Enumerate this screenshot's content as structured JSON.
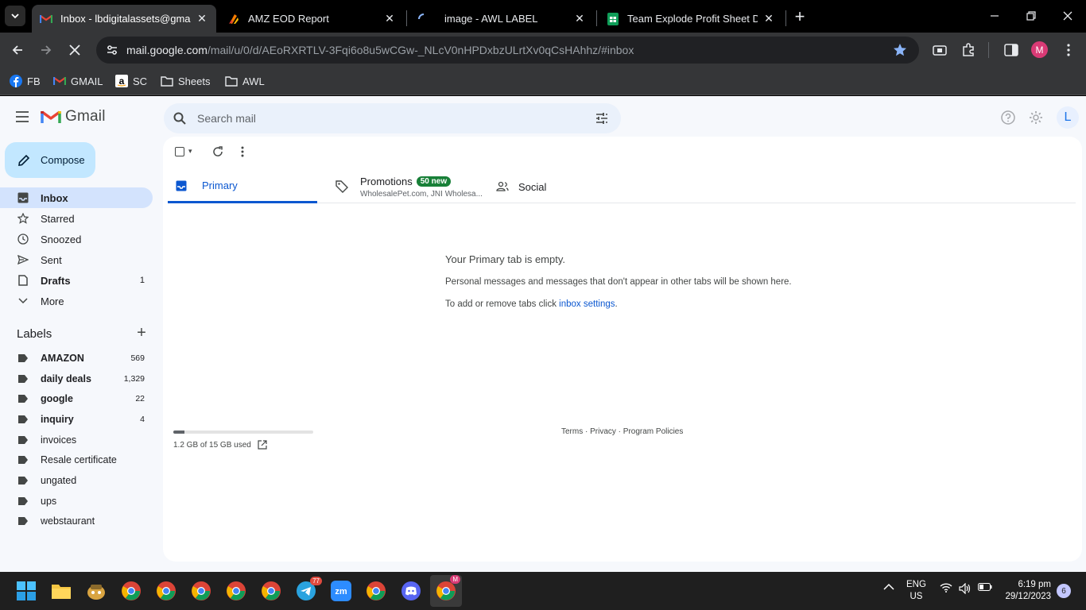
{
  "browser": {
    "tabs": [
      {
        "title": "Inbox - lbdigitalassets@gmail.com",
        "active": true,
        "icon": "gmail-icon"
      },
      {
        "title": "AMZ EOD Report",
        "active": false,
        "icon": "amz-icon"
      },
      {
        "title": "image - AWL LABEL",
        "active": false,
        "icon": "loading-icon"
      },
      {
        "title": "Team Explode Profit Sheet Dec",
        "active": false,
        "icon": "sheets-icon"
      }
    ],
    "url_host": "mail.google.com",
    "url_path": "/mail/u/0/d/AEoRXRTLV-3Fqi6o8u5wCGw-_NLcV0nHPDxbzULrtXv0qCsHAhhz/#inbox",
    "profile_initial": "M",
    "bookmarks": [
      {
        "label": "FB",
        "icon": "facebook-icon"
      },
      {
        "label": "GMAIL",
        "icon": "gmail-icon"
      },
      {
        "label": "SC",
        "icon": "amazon-icon"
      },
      {
        "label": "Sheets",
        "icon": "folder-icon"
      },
      {
        "label": "AWL",
        "icon": "folder-icon"
      }
    ]
  },
  "gmail": {
    "logo_text": "Gmail",
    "search_placeholder": "Search mail",
    "account_initial": "L",
    "compose_label": "Compose",
    "nav": [
      {
        "label": "Inbox",
        "count": "",
        "active": true,
        "bold": true,
        "icon": "inbox-icon"
      },
      {
        "label": "Starred",
        "count": "",
        "active": false,
        "bold": false,
        "icon": "star-icon"
      },
      {
        "label": "Snoozed",
        "count": "",
        "active": false,
        "bold": false,
        "icon": "clock-icon"
      },
      {
        "label": "Sent",
        "count": "",
        "active": false,
        "bold": false,
        "icon": "send-icon"
      },
      {
        "label": "Drafts",
        "count": "1",
        "active": false,
        "bold": true,
        "icon": "draft-icon"
      },
      {
        "label": "More",
        "count": "",
        "active": false,
        "bold": false,
        "icon": "chevron-down-icon"
      }
    ],
    "labels_title": "Labels",
    "labels": [
      {
        "name": "AMAZON",
        "count": "569",
        "bold": true
      },
      {
        "name": "daily deals",
        "count": "1,329",
        "bold": true
      },
      {
        "name": "google",
        "count": "22",
        "bold": true
      },
      {
        "name": "inquiry",
        "count": "4",
        "bold": true
      },
      {
        "name": "invoices",
        "count": "",
        "bold": false
      },
      {
        "name": "Resale certificate",
        "count": "",
        "bold": false
      },
      {
        "name": "ungated",
        "count": "",
        "bold": false
      },
      {
        "name": "ups",
        "count": "",
        "bold": false
      },
      {
        "name": "webstaurant",
        "count": "",
        "bold": false
      }
    ],
    "tabs": {
      "primary": "Primary",
      "promotions": "Promotions",
      "promotions_badge": "50 new",
      "promotions_sub": "WholesalePet.com, JNI Wholesa...",
      "social": "Social"
    },
    "empty": {
      "title": "Your Primary tab is empty.",
      "desc": "Personal messages and messages that don't appear in other tabs will be shown here.",
      "tabs_prefix": "To add or remove tabs click ",
      "tabs_link": "inbox settings",
      "tabs_suffix": "."
    },
    "storage": {
      "text": "1.2 GB of 15 GB used",
      "fraction": 0.08
    },
    "footer": "Terms · Privacy · Program Policies"
  },
  "taskbar": {
    "telegram_badge": "77",
    "chrome_profile_badge": "M",
    "lang_top": "ENG",
    "lang_bottom": "US",
    "time": "6:19 pm",
    "date": "29/12/2023",
    "notifications": "6"
  },
  "colors": {
    "accent": "#0b57d0",
    "compose": "#c2e7ff",
    "active_nav": "#d3e3fd",
    "badge": "#188038"
  }
}
